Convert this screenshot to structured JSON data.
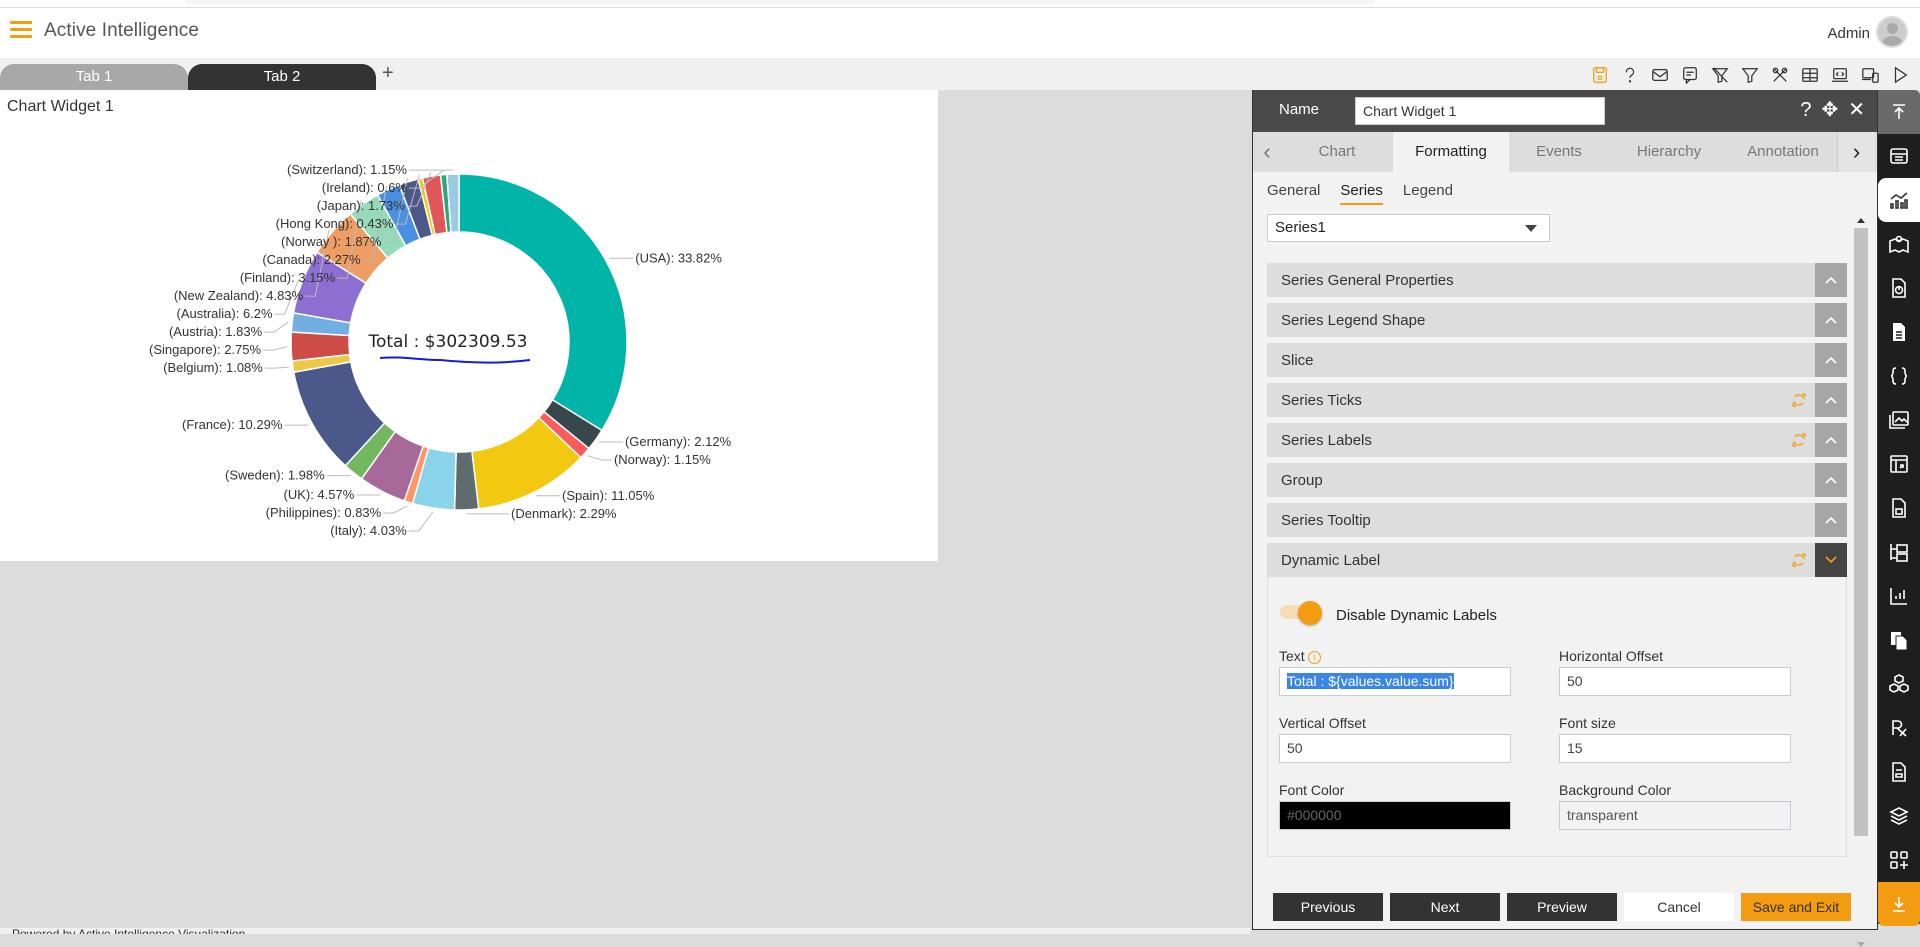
{
  "app": {
    "title": "Active Intelligence",
    "user": "Admin",
    "footer": "Powered by Active Intelligence Visualization"
  },
  "tabs": [
    {
      "label": "Tab 1",
      "active": false
    },
    {
      "label": "Tab 2",
      "active": true
    }
  ],
  "add_tab_label": "+",
  "toolbar_icons": [
    "save-icon",
    "help-icon",
    "mail-icon",
    "comment-icon",
    "clear-filter-icon",
    "filter-icon",
    "tools-icon",
    "table-icon",
    "embed-icon",
    "devices-icon",
    "play-icon"
  ],
  "widget": {
    "title": "Chart Widget 1",
    "dynamic_label": "Total : $302309.53"
  },
  "chart_data": {
    "type": "pie",
    "variant": "donut",
    "title": "Chart Widget 1",
    "center_label": "Total : $302309.53",
    "total": 302309.53,
    "unit": "%",
    "slices": [
      {
        "label": "USA",
        "value": 33.82,
        "color": "#00b5a7"
      },
      {
        "label": "Germany",
        "value": 2.12,
        "color": "#37474a"
      },
      {
        "label": "Norway",
        "value": 1.15,
        "color": "#fb5b5b"
      },
      {
        "label": "Spain",
        "value": 11.05,
        "color": "#f2c811"
      },
      {
        "label": "Denmark",
        "value": 2.29,
        "color": "#5f6b6d"
      },
      {
        "label": "Italy",
        "value": 4.03,
        "color": "#8ad4eb"
      },
      {
        "label": "Philippines",
        "value": 0.83,
        "color": "#fe9666"
      },
      {
        "label": "UK",
        "value": 4.57,
        "color": "#a66999"
      },
      {
        "label": "Sweden",
        "value": 1.98,
        "color": "#73b761"
      },
      {
        "label": "France",
        "value": 10.29,
        "color": "#4a588a"
      },
      {
        "label": "Belgium",
        "value": 1.08,
        "color": "#ecc846"
      },
      {
        "label": "Singapore",
        "value": 2.75,
        "color": "#cd4c46"
      },
      {
        "label": "Austria",
        "value": 1.83,
        "color": "#71afe2"
      },
      {
        "label": "Australia",
        "value": 6.2,
        "color": "#8d6fd1"
      },
      {
        "label": "New Zealand",
        "value": 4.83,
        "color": "#ee9e64"
      },
      {
        "label": "Finland",
        "value": 3.15,
        "color": "#95dabb"
      },
      {
        "label": "Canada",
        "value": 2.27,
        "color": "#4a90e2"
      },
      {
        "label": "Norway ",
        "value": 1.87,
        "color": "#4a588a"
      },
      {
        "label": "Hong Kong",
        "value": 0.43,
        "color": "#f2c811"
      },
      {
        "label": "Japan",
        "value": 1.73,
        "color": "#e15759"
      },
      {
        "label": "Ireland",
        "value": 0.6,
        "color": "#2ea67a"
      },
      {
        "label": "Switzerland",
        "value": 1.15,
        "color": "#9ecae1"
      }
    ],
    "legend": "none",
    "label_format": "(name): pct%"
  },
  "panel": {
    "name_label": "Name",
    "name_value": "Chart Widget 1",
    "tabs": [
      "Chart",
      "Formatting",
      "Events",
      "Hierarchy",
      "Annotation"
    ],
    "active_tab": "Formatting",
    "subtabs": [
      "General",
      "Series",
      "Legend"
    ],
    "active_subtab": "Series",
    "series_select": "Series1",
    "sections": [
      {
        "label": "Series General Properties",
        "refresh": false,
        "open": false
      },
      {
        "label": "Series Legend Shape",
        "refresh": false,
        "open": false
      },
      {
        "label": "Slice",
        "refresh": false,
        "open": false
      },
      {
        "label": "Series Ticks",
        "refresh": true,
        "open": false
      },
      {
        "label": "Series Labels",
        "refresh": true,
        "open": false
      },
      {
        "label": "Group",
        "refresh": false,
        "open": false
      },
      {
        "label": "Series Tooltip",
        "refresh": false,
        "open": false
      },
      {
        "label": "Dynamic Label",
        "refresh": true,
        "open": true
      }
    ],
    "dynamic_label": {
      "toggle_label": "Disable Dynamic Labels",
      "toggle_on": true,
      "text_label": "Text",
      "text_value": "Total : ${values.value.sum}",
      "h_offset_label": "Horizontal Offset",
      "h_offset_value": "50",
      "v_offset_label": "Vertical Offset",
      "v_offset_value": "50",
      "font_size_label": "Font size",
      "font_size_value": "15",
      "font_color_label": "Font Color",
      "font_color_value": "#000000",
      "bg_color_label": "Background Color",
      "bg_color_value": "transparent"
    },
    "buttons": {
      "previous": "Previous",
      "next": "Next",
      "preview": "Preview",
      "cancel": "Cancel",
      "save_exit": "Save and Exit"
    }
  },
  "rail_icons": [
    "scroll-top-icon",
    "table-widget-icon",
    "chart-widget-icon",
    "map-widget-icon",
    "report-widget-icon",
    "document-widget-icon",
    "code-widget-icon",
    "image-widget-icon",
    "layout-widget-icon",
    "calculator-widget-icon",
    "tree-widget-icon",
    "kpi-widget-icon",
    "copy-widget-icon",
    "cube-widget-icon",
    "rx-widget-icon",
    "form-widget-icon",
    "layers-widget-icon",
    "add-widget-icon",
    "scroll-bottom-icon"
  ],
  "colors": {
    "accent": "#f39c12",
    "dark": "#333333",
    "panel_header": "#4a4a4a",
    "rail": "#1e1e1e"
  }
}
